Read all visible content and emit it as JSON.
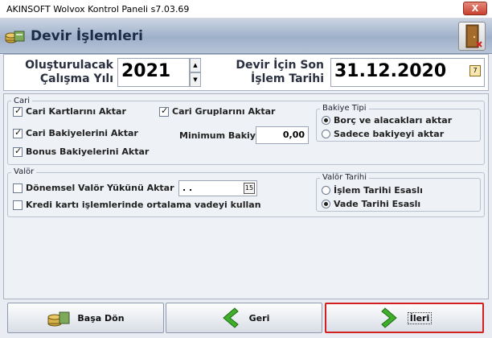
{
  "window": {
    "title": "AKINSOFT Wolvox Kontrol Paneli s7.03.69",
    "close_label": "X"
  },
  "header": {
    "title": "Devir İşlemleri"
  },
  "top": {
    "year_label_1": "Oluşturulacak",
    "year_label_2": "Çalışma Yılı",
    "year_value": "2021",
    "date_label_1": "Devir İçin Son",
    "date_label_2": "İşlem Tarihi",
    "date_value": "31.12.2020",
    "calendar_glyph": "7"
  },
  "cari": {
    "title": "Cari",
    "kartlar": "Cari Kartlarını Aktar",
    "gruplar": "Cari Gruplarını Aktar",
    "bakiyeler": "Cari Bakiyelerini Aktar",
    "bonus": "Bonus Bakiyelerini Aktar",
    "min_label": "Minimum Bakiye",
    "min_value": "0,00"
  },
  "bakiye_tipi": {
    "title": "Bakiye Tipi",
    "opt1": "Borç ve alacakları aktar",
    "opt2": "Sadece bakiyeyi aktar"
  },
  "valor": {
    "title": "Valör",
    "donemsel": "Dönemsel Valör Yükünü Aktar",
    "date_value": " .  .",
    "cal_glyph": "15",
    "kredi": "Kredi kartı işlemlerinde ortalama vadeyi kullan"
  },
  "valor_tarihi": {
    "title": "Valör Tarihi",
    "opt1": "İşlem Tarihi Esaslı",
    "opt2": "Vade Tarihi Esaslı"
  },
  "footer": {
    "basa_don": "Başa Dön",
    "geri": "Geri",
    "ileri": "İleri"
  }
}
